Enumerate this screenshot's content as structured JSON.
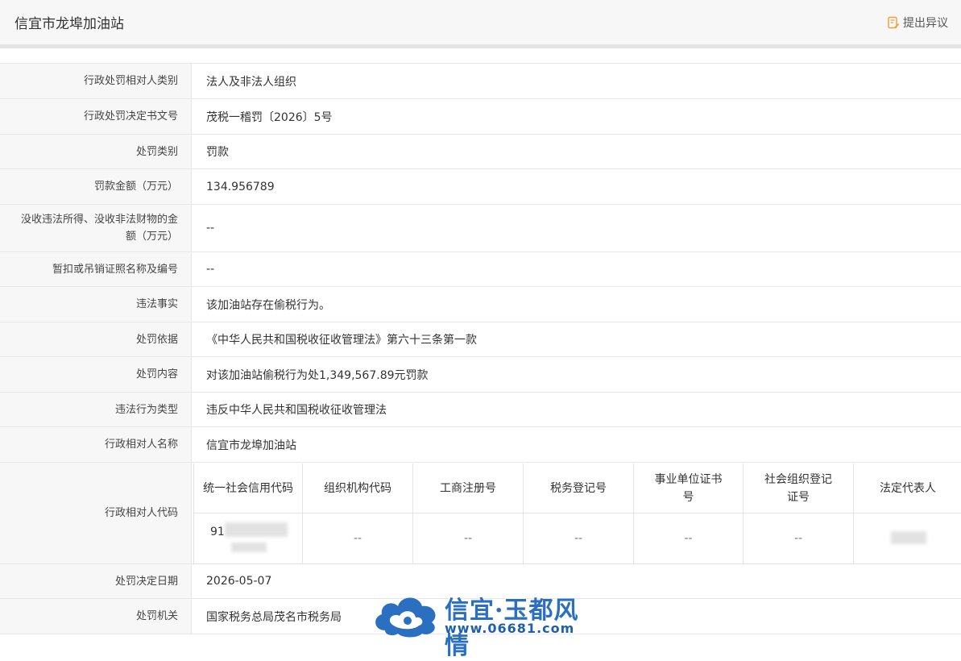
{
  "header": {
    "title": "信宜市龙埠加油站",
    "objection_label": "提出异议"
  },
  "rows": [
    {
      "label": "行政处罚相对人类别",
      "value": "法人及非法人组织"
    },
    {
      "label": "行政处罚决定书文号",
      "value": "茂税一稽罚〔2026〕5号"
    },
    {
      "label": "处罚类别",
      "value": "罚款"
    },
    {
      "label": "罚款金额（万元）",
      "value": "134.956789"
    },
    {
      "label": "没收违法所得、没收非法财物的金额（万元）",
      "value": "--"
    },
    {
      "label": "暂扣或吊销证照名称及编号",
      "value": "--"
    },
    {
      "label": "违法事实",
      "value": "该加油站存在偷税行为。"
    },
    {
      "label": "处罚依据",
      "value": "《中华人民共和国税收征收管理法》第六十三条第一款"
    },
    {
      "label": "处罚内容",
      "value": "对该加油站偷税行为处1,349,567.89元罚款"
    },
    {
      "label": "违法行为类型",
      "value": "违反中华人民共和国税收征收管理法"
    },
    {
      "label": "行政相对人名称",
      "value": "信宜市龙埠加油站"
    },
    {
      "label": "行政相对人代码",
      "value": ""
    },
    {
      "label": "处罚决定日期",
      "value": "2026-05-07"
    },
    {
      "label": "处罚机关",
      "value": "国家税务总局茂名市税务局"
    }
  ],
  "code_table": {
    "headers": [
      "统一社会信用代码",
      "组织机构代码",
      "工商注册号",
      "税务登记号",
      "事业单位证书号",
      "社会组织登记证号",
      "法定代表人"
    ],
    "values": [
      "91",
      "--",
      "--",
      "--",
      "--",
      "--",
      ""
    ]
  },
  "watermark": {
    "title": "信宜·玉都风情",
    "url": "www.06681.com"
  },
  "colors": {
    "accent": "#e6a23c",
    "label_bg": "#f7f7f7",
    "border": "#e8e8e8",
    "watermark": "#2a6fc0"
  },
  "icons": {
    "objection": "edit-document-icon"
  }
}
